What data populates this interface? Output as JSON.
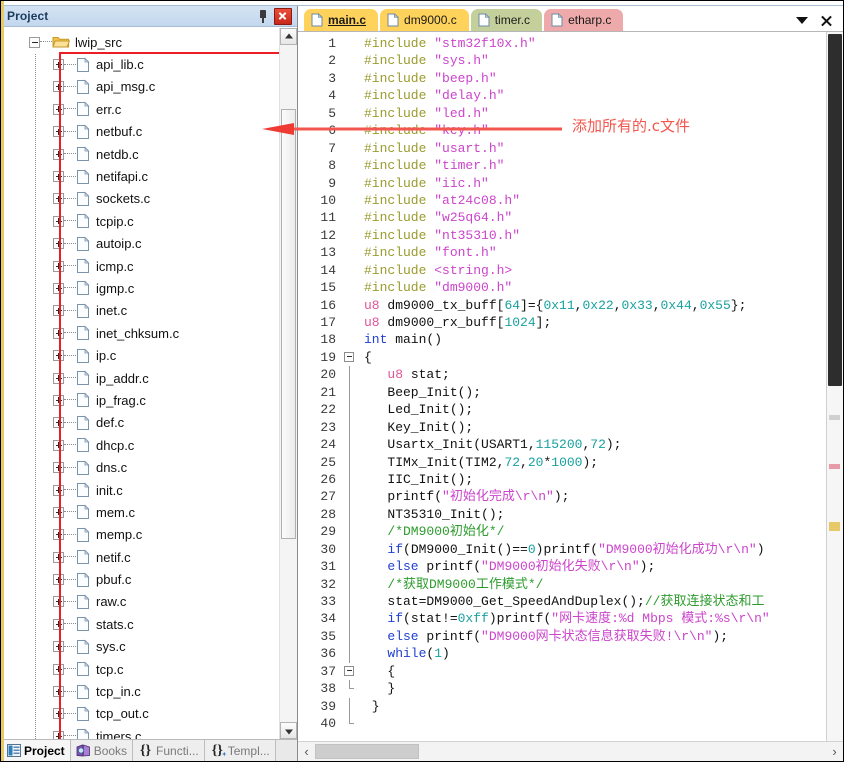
{
  "project_panel": {
    "title": "Project",
    "pin_icon": "pin-icon",
    "close_icon": "close-icon",
    "root_node": {
      "label": "lwip_src",
      "icon": "folder-icon",
      "expander": "minus"
    },
    "files": [
      "api_lib.c",
      "api_msg.c",
      "err.c",
      "netbuf.c",
      "netdb.c",
      "netifapi.c",
      "sockets.c",
      "tcpip.c",
      "autoip.c",
      "icmp.c",
      "igmp.c",
      "inet.c",
      "inet_chksum.c",
      "ip.c",
      "ip_addr.c",
      "ip_frag.c",
      "def.c",
      "dhcp.c",
      "dns.c",
      "init.c",
      "mem.c",
      "memp.c",
      "netif.c",
      "pbuf.c",
      "raw.c",
      "stats.c",
      "sys.c",
      "tcp.c",
      "tcp_in.c",
      "tcp_out.c",
      "timers.c"
    ],
    "bottom_tabs": [
      {
        "label": "Project",
        "icon": "project-icon",
        "active": true
      },
      {
        "label": "Books",
        "icon": "books-icon",
        "active": false
      },
      {
        "label": "Functi...",
        "icon": "braces-icon",
        "active": false
      },
      {
        "label": "Templ...",
        "icon": "template-icon",
        "active": false
      }
    ]
  },
  "editor": {
    "tabs": [
      {
        "label": "main.c",
        "color": "#ffd25c",
        "active": true
      },
      {
        "label": "dm9000.c",
        "color": "#ffd25c",
        "active": false
      },
      {
        "label": "timer.c",
        "color": "#c3d09b",
        "active": false
      },
      {
        "label": "etharp.c",
        "color": "#eeaaaa",
        "active": false
      }
    ],
    "tab_menu_icon": "chevron-down-icon",
    "tab_close_icon": "close-icon",
    "hscroll_left_icon": "chevron-left-icon",
    "hscroll_right_icon": "chevron-right-icon",
    "lines": [
      {
        "n": 1,
        "fold": "",
        "tokens": [
          [
            "pre",
            "#include "
          ],
          [
            "str",
            "\"stm32f10x.h\""
          ]
        ]
      },
      {
        "n": 2,
        "fold": "",
        "tokens": [
          [
            "pre",
            "#include "
          ],
          [
            "str",
            "\"sys.h\""
          ]
        ]
      },
      {
        "n": 3,
        "fold": "",
        "tokens": [
          [
            "pre",
            "#include "
          ],
          [
            "str",
            "\"beep.h\""
          ]
        ]
      },
      {
        "n": 4,
        "fold": "",
        "tokens": [
          [
            "pre",
            "#include "
          ],
          [
            "str",
            "\"delay.h\""
          ]
        ]
      },
      {
        "n": 5,
        "fold": "",
        "tokens": [
          [
            "pre",
            "#include "
          ],
          [
            "str",
            "\"led.h\""
          ]
        ]
      },
      {
        "n": 6,
        "fold": "",
        "tokens": [
          [
            "pre",
            "#include "
          ],
          [
            "str",
            "\"key.h\""
          ]
        ]
      },
      {
        "n": 7,
        "fold": "",
        "tokens": [
          [
            "pre",
            "#include "
          ],
          [
            "str",
            "\"usart.h\""
          ]
        ]
      },
      {
        "n": 8,
        "fold": "",
        "tokens": [
          [
            "pre",
            "#include "
          ],
          [
            "str",
            "\"timer.h\""
          ]
        ]
      },
      {
        "n": 9,
        "fold": "",
        "tokens": [
          [
            "pre",
            "#include "
          ],
          [
            "str",
            "\"iic.h\""
          ]
        ]
      },
      {
        "n": 10,
        "fold": "",
        "tokens": [
          [
            "pre",
            "#include "
          ],
          [
            "str",
            "\"at24c08.h\""
          ]
        ]
      },
      {
        "n": 11,
        "fold": "",
        "tokens": [
          [
            "pre",
            "#include "
          ],
          [
            "str",
            "\"w25q64.h\""
          ]
        ]
      },
      {
        "n": 12,
        "fold": "",
        "tokens": [
          [
            "pre",
            "#include "
          ],
          [
            "str",
            "\"nt35310.h\""
          ]
        ]
      },
      {
        "n": 13,
        "fold": "",
        "tokens": [
          [
            "pre",
            "#include "
          ],
          [
            "str",
            "\"font.h\""
          ]
        ]
      },
      {
        "n": 14,
        "fold": "",
        "tokens": [
          [
            "pre",
            "#include "
          ],
          [
            "str",
            "<string.h>"
          ]
        ]
      },
      {
        "n": 15,
        "fold": "",
        "tokens": [
          [
            "pre",
            "#include "
          ],
          [
            "str",
            "\"dm9000.h\""
          ]
        ]
      },
      {
        "n": 16,
        "fold": "",
        "tokens": [
          [
            "type",
            "u8"
          ],
          [
            "txt",
            " dm9000_tx_buff["
          ],
          [
            "num",
            "64"
          ],
          [
            "txt",
            "]={"
          ],
          [
            "num",
            "0x11"
          ],
          [
            "txt",
            ","
          ],
          [
            "num",
            "0x22"
          ],
          [
            "txt",
            ","
          ],
          [
            "num",
            "0x33"
          ],
          [
            "txt",
            ","
          ],
          [
            "num",
            "0x44"
          ],
          [
            "txt",
            ","
          ],
          [
            "num",
            "0x55"
          ],
          [
            "txt",
            "};"
          ]
        ]
      },
      {
        "n": 17,
        "fold": "",
        "tokens": [
          [
            "type",
            "u8"
          ],
          [
            "txt",
            " dm9000_rx_buff["
          ],
          [
            "num",
            "1024"
          ],
          [
            "txt",
            "];"
          ]
        ]
      },
      {
        "n": 18,
        "fold": "",
        "tokens": [
          [
            "kw",
            "int"
          ],
          [
            "txt",
            " main()"
          ]
        ]
      },
      {
        "n": 19,
        "fold": "start",
        "tokens": [
          [
            "txt",
            "{"
          ]
        ]
      },
      {
        "n": 20,
        "fold": "mid",
        "tokens": [
          [
            "txt",
            "   "
          ],
          [
            "type",
            "u8"
          ],
          [
            "txt",
            " stat;"
          ]
        ]
      },
      {
        "n": 21,
        "fold": "mid",
        "tokens": [
          [
            "txt",
            "   Beep_Init();"
          ]
        ]
      },
      {
        "n": 22,
        "fold": "mid",
        "tokens": [
          [
            "txt",
            "   Led_Init();"
          ]
        ]
      },
      {
        "n": 23,
        "fold": "mid",
        "tokens": [
          [
            "txt",
            "   Key_Init();"
          ]
        ]
      },
      {
        "n": 24,
        "fold": "mid",
        "tokens": [
          [
            "txt",
            "   Usartx_Init(USART1,"
          ],
          [
            "num",
            "115200"
          ],
          [
            "txt",
            ","
          ],
          [
            "num",
            "72"
          ],
          [
            "txt",
            ");"
          ]
        ]
      },
      {
        "n": 25,
        "fold": "mid",
        "tokens": [
          [
            "txt",
            "   TIMx_Init(TIM2,"
          ],
          [
            "num",
            "72"
          ],
          [
            "txt",
            ","
          ],
          [
            "num",
            "20"
          ],
          [
            "txt",
            "*"
          ],
          [
            "num",
            "1000"
          ],
          [
            "txt",
            ");"
          ]
        ]
      },
      {
        "n": 26,
        "fold": "mid",
        "tokens": [
          [
            "txt",
            "   IIC_Init();"
          ]
        ]
      },
      {
        "n": 27,
        "fold": "mid",
        "tokens": [
          [
            "txt",
            "   printf("
          ],
          [
            "str",
            "\"初始化完成\\r\\n\""
          ],
          [
            "txt",
            ");"
          ]
        ]
      },
      {
        "n": 28,
        "fold": "mid",
        "tokens": [
          [
            "txt",
            "   NT35310_Init();"
          ]
        ]
      },
      {
        "n": 29,
        "fold": "mid",
        "tokens": [
          [
            "txt",
            "   "
          ],
          [
            "cmt",
            "/*DM9000初始化*/"
          ]
        ]
      },
      {
        "n": 30,
        "fold": "mid",
        "tokens": [
          [
            "txt",
            "   "
          ],
          [
            "kw",
            "if"
          ],
          [
            "txt",
            "(DM9000_Init()=="
          ],
          [
            "num",
            "0"
          ],
          [
            "txt",
            ")printf("
          ],
          [
            "str",
            "\"DM9000初始化成功\\r\\n\""
          ],
          [
            "txt",
            ")"
          ]
        ]
      },
      {
        "n": 31,
        "fold": "mid",
        "tokens": [
          [
            "txt",
            "   "
          ],
          [
            "kw",
            "else"
          ],
          [
            "txt",
            " printf("
          ],
          [
            "str",
            "\"DM9000初始化失败\\r\\n\""
          ],
          [
            "txt",
            ");"
          ]
        ]
      },
      {
        "n": 32,
        "fold": "mid",
        "tokens": [
          [
            "txt",
            "   "
          ],
          [
            "cmt",
            "/*获取DM9000工作模式*/"
          ]
        ]
      },
      {
        "n": 33,
        "fold": "mid",
        "tokens": [
          [
            "txt",
            "   stat=DM9000_Get_SpeedAndDuplex();"
          ],
          [
            "cmt",
            "//获取连接状态和工"
          ]
        ]
      },
      {
        "n": 34,
        "fold": "mid",
        "tokens": [
          [
            "txt",
            "   "
          ],
          [
            "kw",
            "if"
          ],
          [
            "txt",
            "(stat!="
          ],
          [
            "num",
            "0xff"
          ],
          [
            "txt",
            ")printf("
          ],
          [
            "str",
            "\"网卡速度:%d Mbps 模式:%s\\r\\n"
          ],
          [
            "str",
            "\""
          ]
        ]
      },
      {
        "n": 35,
        "fold": "mid",
        "tokens": [
          [
            "txt",
            "   "
          ],
          [
            "kw",
            "else"
          ],
          [
            "txt",
            " printf("
          ],
          [
            "str",
            "\"DM9000网卡状态信息获取失败!\\r\\n\""
          ],
          [
            "txt",
            ");"
          ]
        ]
      },
      {
        "n": 36,
        "fold": "mid",
        "tokens": [
          [
            "txt",
            "   "
          ],
          [
            "kw",
            "while"
          ],
          [
            "txt",
            "("
          ],
          [
            "num",
            "1"
          ],
          [
            "txt",
            ")"
          ]
        ]
      },
      {
        "n": 37,
        "fold": "start2",
        "tokens": [
          [
            "txt",
            "   {"
          ]
        ]
      },
      {
        "n": 38,
        "fold": "end2",
        "tokens": [
          [
            "txt",
            "   }"
          ]
        ]
      },
      {
        "n": 39,
        "fold": "mid",
        "tokens": [
          [
            "txt",
            " }"
          ]
        ]
      },
      {
        "n": 40,
        "fold": "end",
        "tokens": [
          [
            "txt",
            ""
          ]
        ]
      }
    ]
  },
  "annotation": {
    "text": "添加所有的.c文件",
    "color": "#f2564e",
    "arrow_icon": "left-arrow-icon"
  }
}
